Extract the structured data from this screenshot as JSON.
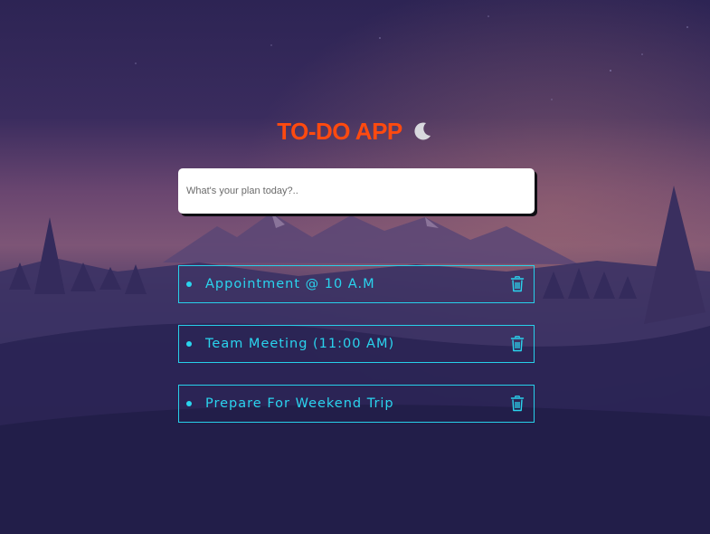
{
  "app": {
    "title": "TO-DO APP"
  },
  "input": {
    "placeholder": "What's your plan today?..",
    "value": ""
  },
  "todos": [
    {
      "text": "Appointment @ 10 A.M"
    },
    {
      "text": "Team Meeting (11:00 AM)"
    },
    {
      "text": "Prepare For Weekend Trip"
    }
  ],
  "icons": {
    "title_icon": "moon-icon",
    "delete_icon": "trash-icon",
    "item_marker": "bullet"
  },
  "colors": {
    "title": "#ff4a0f",
    "accent": "#2ad4ee",
    "background": "#2a2450",
    "input_bg": "#ffffff"
  }
}
